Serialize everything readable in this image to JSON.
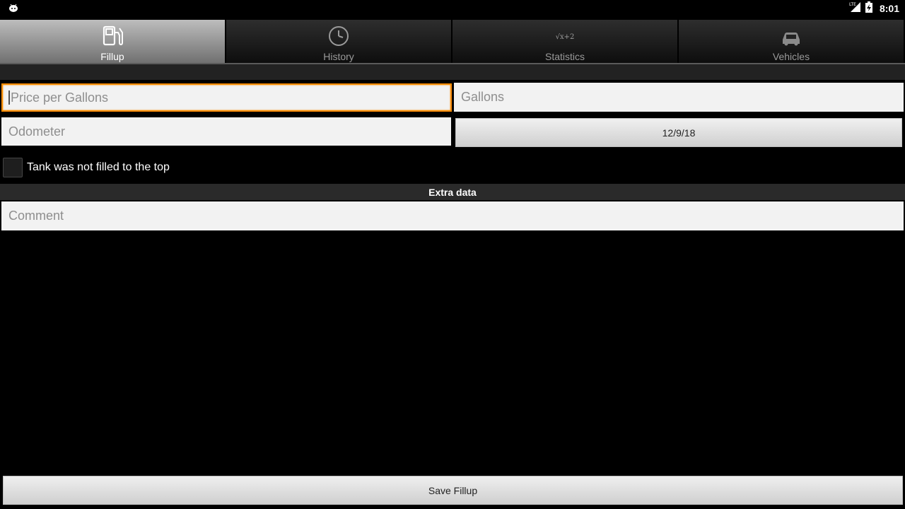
{
  "status_bar": {
    "network": "LTE",
    "time": "8:01"
  },
  "tabs": [
    {
      "label": "Fillup",
      "icon": "fuel-pump-icon",
      "active": true
    },
    {
      "label": "History",
      "icon": "clock-icon",
      "active": false
    },
    {
      "label": "Statistics",
      "icon": "formula-icon",
      "icon_text": "√x+2",
      "active": false
    },
    {
      "label": "Vehicles",
      "icon": "car-icon",
      "active": false
    }
  ],
  "form": {
    "price_placeholder": "Price per Gallons",
    "gallons_placeholder": "Gallons",
    "odometer_placeholder": "Odometer",
    "date_value": "12/9/18",
    "partial_fill_label": "Tank was not filled to the top",
    "partial_fill_checked": false,
    "extra_header": "Extra data",
    "comment_placeholder": "Comment",
    "save_label": "Save Fillup"
  },
  "colors": {
    "focus_accent": "#ff8c00",
    "background": "#000000"
  }
}
